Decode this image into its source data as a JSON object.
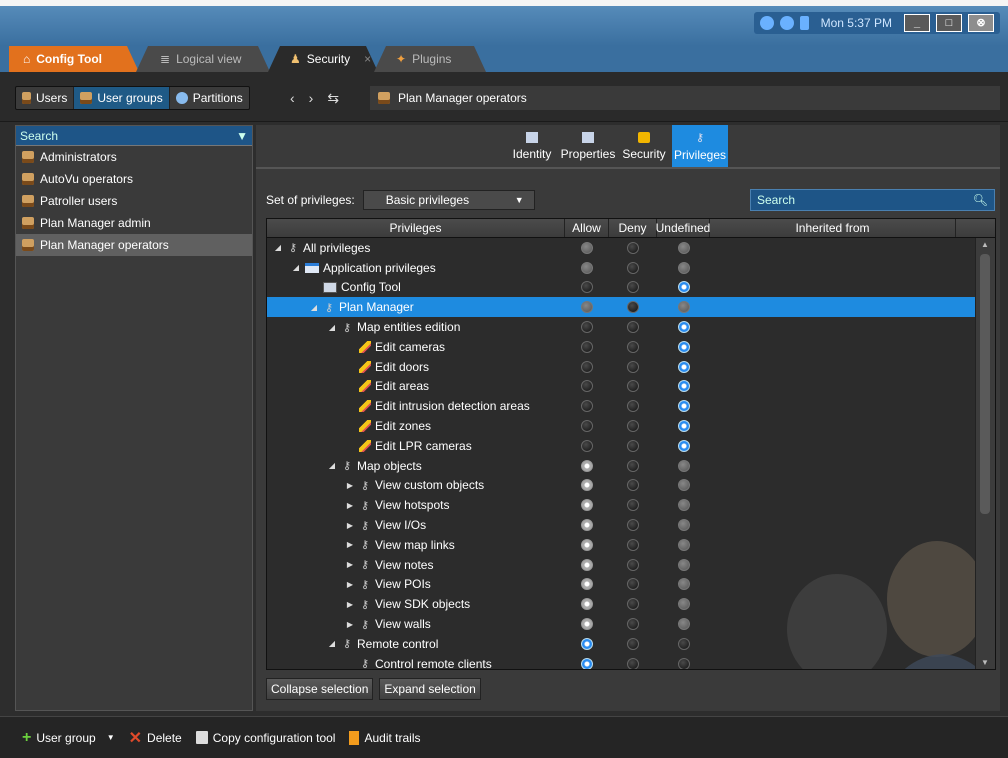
{
  "system": {
    "clock": "Mon 5:37 PM"
  },
  "tabs": [
    {
      "label": "Config Tool"
    },
    {
      "label": "Logical view"
    },
    {
      "label": "Security",
      "close": "×"
    },
    {
      "label": "Plugins"
    }
  ],
  "toolbar": {
    "segments": [
      "Users",
      "User groups",
      "Partitions"
    ],
    "active_segment": "User groups",
    "breadcrumb": "Plan Manager operators"
  },
  "left": {
    "search_placeholder": "Search",
    "items": [
      "Administrators",
      "AutoVu operators",
      "Patroller users",
      "Plan Manager admin",
      "Plan Manager operators"
    ],
    "selected": "Plan Manager operators"
  },
  "view_tabs": [
    "Identity",
    "Properties",
    "Security",
    "Privileges"
  ],
  "active_view_tab": "Privileges",
  "privset": {
    "label": "Set of privileges:",
    "value": "Basic privileges"
  },
  "right_search": "Search",
  "grid": {
    "columns": [
      "Privileges",
      "Allow",
      "Deny",
      "Undefined",
      "Inherited from"
    ],
    "rows": [
      {
        "label": "All privileges",
        "level": 0,
        "exp": "open",
        "icon": "key",
        "state": [
          "gray",
          "off",
          "gray"
        ]
      },
      {
        "label": "Application privileges",
        "level": 1,
        "exp": "open",
        "icon": "folder",
        "state": [
          "gray",
          "off",
          "gray"
        ]
      },
      {
        "label": "Config Tool",
        "level": 2,
        "exp": "",
        "icon": "cfg",
        "state": [
          "off",
          "off",
          "on"
        ]
      },
      {
        "label": "Plan Manager",
        "level": 2,
        "exp": "open",
        "icon": "key",
        "state": [
          "gray",
          "off",
          "gray"
        ],
        "selected": true
      },
      {
        "label": "Map entities edition",
        "level": 3,
        "exp": "open",
        "icon": "key",
        "state": [
          "off",
          "off",
          "on"
        ]
      },
      {
        "label": "Edit cameras",
        "level": 4,
        "exp": "",
        "icon": "pencil",
        "state": [
          "off",
          "off",
          "on"
        ]
      },
      {
        "label": "Edit doors",
        "level": 4,
        "exp": "",
        "icon": "pencil",
        "state": [
          "off",
          "off",
          "on"
        ]
      },
      {
        "label": "Edit areas",
        "level": 4,
        "exp": "",
        "icon": "pencil",
        "state": [
          "off",
          "off",
          "on"
        ]
      },
      {
        "label": "Edit intrusion detection areas",
        "level": 4,
        "exp": "",
        "icon": "pencil",
        "state": [
          "off",
          "off",
          "on"
        ]
      },
      {
        "label": "Edit zones",
        "level": 4,
        "exp": "",
        "icon": "pencil",
        "state": [
          "off",
          "off",
          "on"
        ]
      },
      {
        "label": "Edit LPR cameras",
        "level": 4,
        "exp": "",
        "icon": "pencil",
        "state": [
          "off",
          "off",
          "on"
        ]
      },
      {
        "label": "Map objects",
        "level": 3,
        "exp": "open",
        "icon": "key",
        "state": [
          "grayon",
          "off",
          "gray"
        ]
      },
      {
        "label": "View custom objects",
        "level": 4,
        "exp": "closed",
        "icon": "key",
        "state": [
          "grayon",
          "off",
          "gray"
        ]
      },
      {
        "label": "View hotspots",
        "level": 4,
        "exp": "closed",
        "icon": "key",
        "state": [
          "grayon",
          "off",
          "gray"
        ]
      },
      {
        "label": "View I/Os",
        "level": 4,
        "exp": "closed",
        "icon": "key",
        "state": [
          "grayon",
          "off",
          "gray"
        ]
      },
      {
        "label": "View map links",
        "level": 4,
        "exp": "closed",
        "icon": "key",
        "state": [
          "grayon",
          "off",
          "gray"
        ]
      },
      {
        "label": "View notes",
        "level": 4,
        "exp": "closed",
        "icon": "key",
        "state": [
          "grayon",
          "off",
          "gray"
        ]
      },
      {
        "label": "View POIs",
        "level": 4,
        "exp": "closed",
        "icon": "key",
        "state": [
          "grayon",
          "off",
          "gray"
        ]
      },
      {
        "label": "View SDK objects",
        "level": 4,
        "exp": "closed",
        "icon": "key",
        "state": [
          "grayon",
          "off",
          "gray"
        ]
      },
      {
        "label": "View walls",
        "level": 4,
        "exp": "closed",
        "icon": "key",
        "state": [
          "grayon",
          "off",
          "gray"
        ]
      },
      {
        "label": "Remote control",
        "level": 3,
        "exp": "open",
        "icon": "key",
        "state": [
          "on",
          "off",
          "off"
        ]
      },
      {
        "label": "Control remote clients",
        "level": 4,
        "exp": "",
        "icon": "key",
        "state": [
          "on",
          "off",
          "off"
        ]
      }
    ]
  },
  "grid_buttons": [
    "Collapse selection",
    "Expand selection"
  ],
  "bottom": {
    "add": "User group",
    "delete": "Delete",
    "copy": "Copy configuration tool",
    "audit": "Audit trails"
  }
}
